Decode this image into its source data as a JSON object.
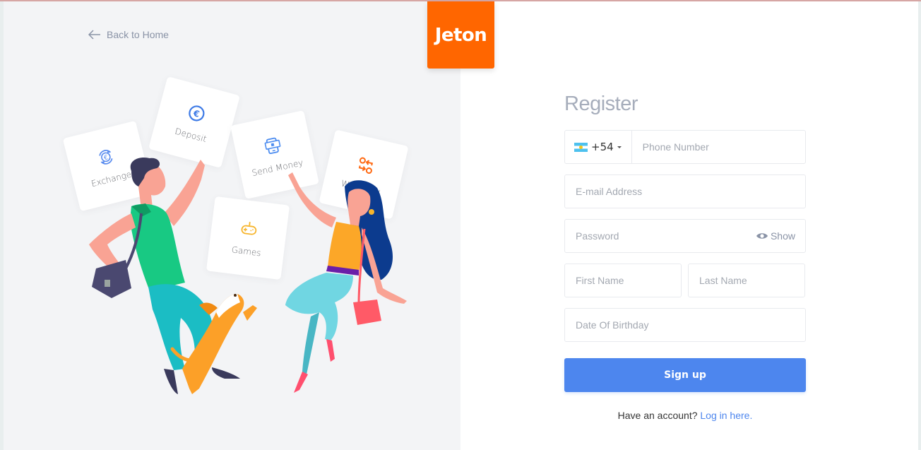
{
  "brand": {
    "name": "Jeton",
    "color": "#ff6600"
  },
  "nav": {
    "back_label": "Back to Home"
  },
  "illustration": {
    "cards": [
      {
        "label": "Exchange",
        "icon": "euro-exchange-icon",
        "color": "#5b8def"
      },
      {
        "label": "Deposit",
        "icon": "euro-coin-icon",
        "color": "#3d7ae6"
      },
      {
        "label": "Send Money",
        "icon": "phone-money-icon",
        "color": "#4d8df0"
      },
      {
        "label": "Withdraw",
        "icon": "swap-icon",
        "color": "#ff6a13"
      },
      {
        "label": "Games",
        "icon": "gamepad-icon",
        "color": "#f7b52c"
      }
    ]
  },
  "form": {
    "title": "Register",
    "phone": {
      "country_flag": "argentina-flag",
      "country_code": "+54",
      "placeholder": "Phone Number"
    },
    "email": {
      "placeholder": "E-mail Address"
    },
    "password": {
      "placeholder": "Password",
      "toggle_label": "Show"
    },
    "first_name": {
      "placeholder": "First Name"
    },
    "last_name": {
      "placeholder": "Last Name"
    },
    "birthday": {
      "placeholder": "Date Of Birthday"
    },
    "submit_label": "Sign up",
    "login_prompt": "Have an account?",
    "login_link": "Log in here.",
    "accent_color": "#4d86ee"
  }
}
